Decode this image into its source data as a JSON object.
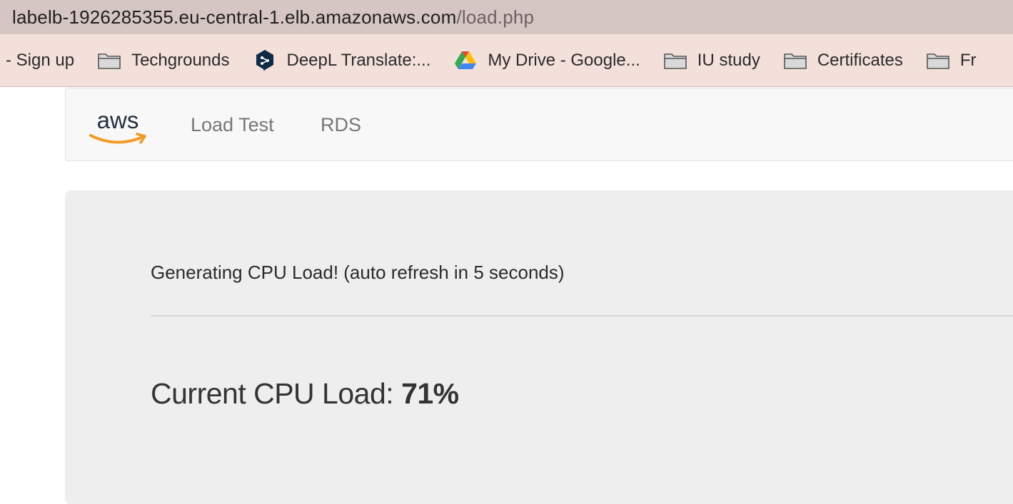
{
  "browser": {
    "url_host": "labelb-1926285355.eu-central-1.elb.amazonaws.com",
    "url_path": "/load.php"
  },
  "bookmarks": [
    {
      "label": "- Sign up",
      "icon": "none"
    },
    {
      "label": "Techgrounds",
      "icon": "folder-icon"
    },
    {
      "label": "DeepL Translate:...",
      "icon": "deepl-icon"
    },
    {
      "label": "My Drive - Google...",
      "icon": "google-drive-icon"
    },
    {
      "label": "IU study",
      "icon": "folder-icon"
    },
    {
      "label": "Certificates",
      "icon": "folder-icon"
    },
    {
      "label": "Fr",
      "icon": "folder-icon"
    }
  ],
  "navbar": {
    "logo_text": "aws",
    "links": [
      "Load Test",
      "RDS"
    ]
  },
  "main": {
    "status_text": "Generating CPU Load! (auto refresh in 5 seconds)",
    "cpu_label": "Current CPU Load: ",
    "cpu_value": "71%"
  },
  "colors": {
    "address_bar_bg": "#d6c6c3",
    "bookmarks_bar_bg": "#f3e0da",
    "aws_orange": "#f29b26",
    "jumbotron_bg": "#eeeeee"
  }
}
